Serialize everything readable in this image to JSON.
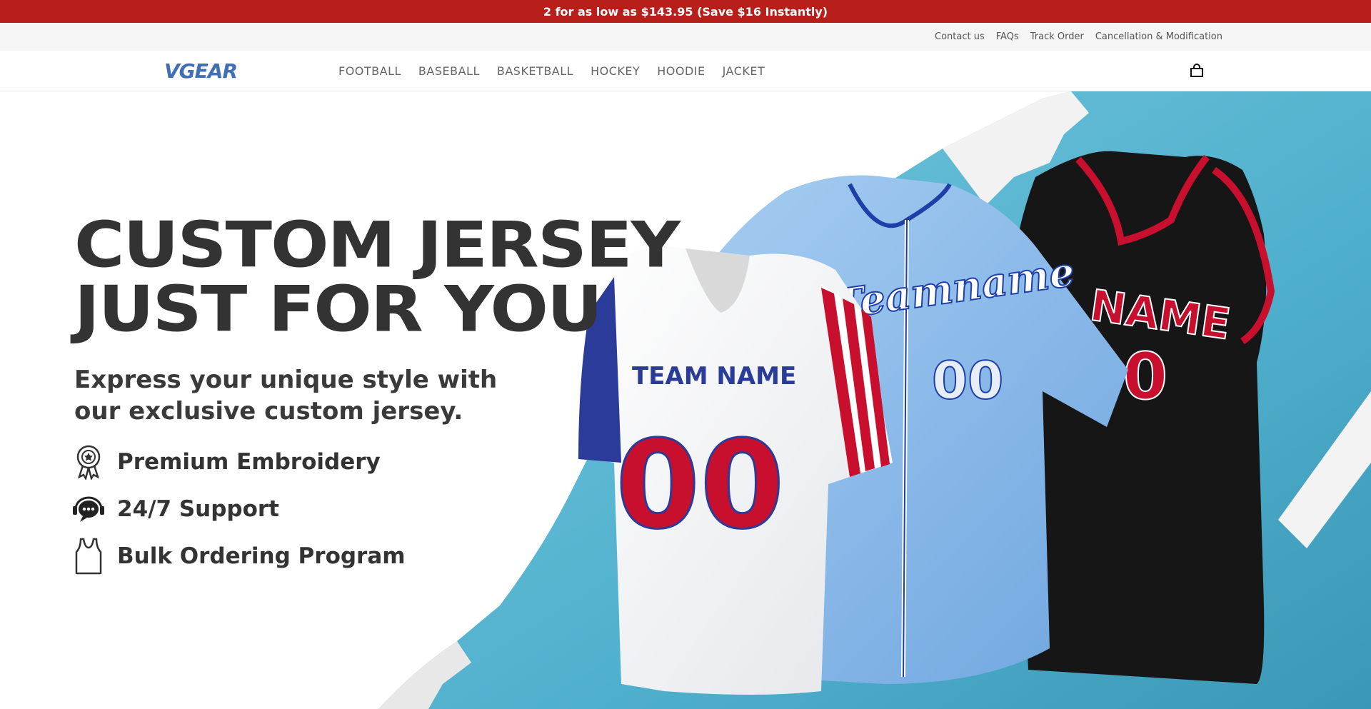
{
  "announcement": {
    "text": "2 for as low as $143.95 (Save $16 Instantly)"
  },
  "utility_links": [
    "Contact us",
    "FAQs",
    "Track Order",
    "Cancellation & Modification"
  ],
  "header": {
    "logo": "VGEAR",
    "nav": [
      "FOOTBALL",
      "BASEBALL",
      "BASKETBALL",
      "HOCKEY",
      "HOODIE",
      "JACKET"
    ],
    "cart_icon": "shopping-bag-icon"
  },
  "hero": {
    "title_line1": "CUSTOM JERSEY",
    "title_line2": "JUST FOR YOU",
    "subtitle": "Express your unique style with our exclusive custom jersey.",
    "features": [
      {
        "icon": "medal-ribbon-icon",
        "label": "Premium Embroidery"
      },
      {
        "icon": "support-chat-icon",
        "label": "24/7 Support"
      },
      {
        "icon": "tank-top-icon",
        "label": "Bulk Ordering Program"
      }
    ],
    "jerseys": {
      "white": {
        "team": "TEAM NAME",
        "number": "00"
      },
      "blue": {
        "team": "Teamname",
        "number": "00"
      },
      "black": {
        "team": "NAME",
        "number": "00"
      }
    }
  },
  "colors": {
    "announcement_bg": "#b81e1a",
    "logo": "#3f6fb4",
    "text_dark": "#333333",
    "pool": "#5bb8d4"
  }
}
